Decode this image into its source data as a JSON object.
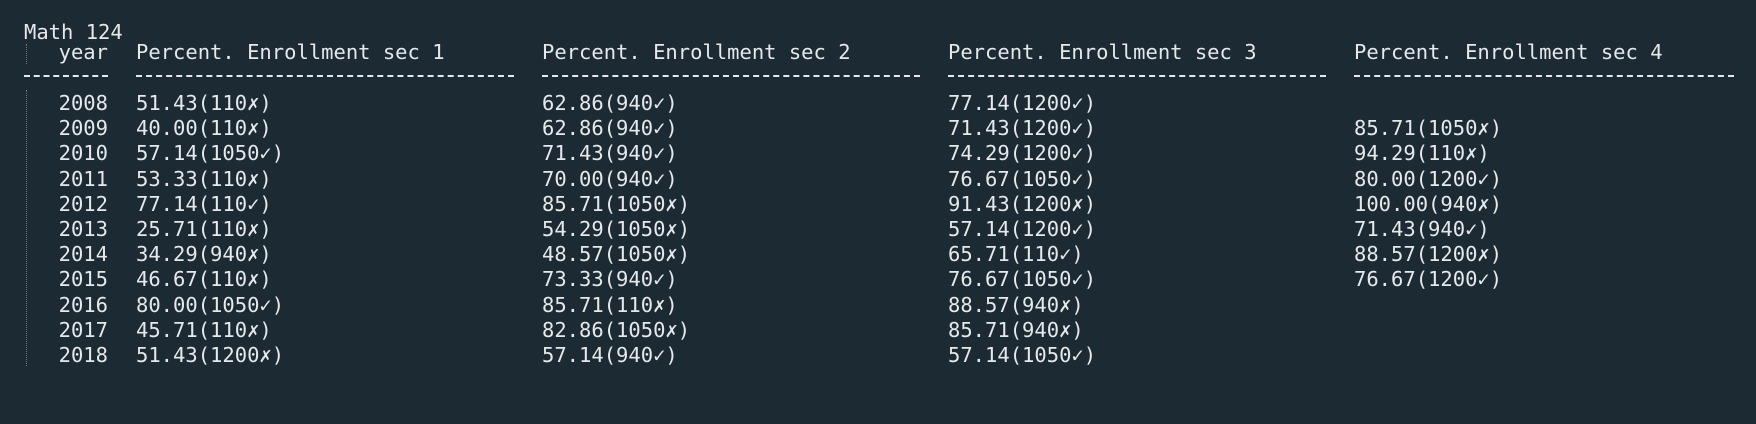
{
  "title": "Math 124",
  "columns": [
    "year",
    "Percent. Enrollment sec 1",
    "Percent. Enrollment sec 2",
    "Percent. Enrollment sec 3",
    "Percent. Enrollment sec 4"
  ],
  "rows": [
    {
      "year": "2008",
      "sec1": "51.43(110✗)",
      "sec2": "62.86(940✓)",
      "sec3": "77.14(1200✓)",
      "sec4": ""
    },
    {
      "year": "2009",
      "sec1": "40.00(110✗)",
      "sec2": "62.86(940✓)",
      "sec3": "71.43(1200✓)",
      "sec4": "85.71(1050✗)"
    },
    {
      "year": "2010",
      "sec1": "57.14(1050✓)",
      "sec2": "71.43(940✓)",
      "sec3": "74.29(1200✓)",
      "sec4": "94.29(110✗)"
    },
    {
      "year": "2011",
      "sec1": "53.33(110✗)",
      "sec2": "70.00(940✓)",
      "sec3": "76.67(1050✓)",
      "sec4": "80.00(1200✓)"
    },
    {
      "year": "2012",
      "sec1": "77.14(110✓)",
      "sec2": "85.71(1050✗)",
      "sec3": "91.43(1200✗)",
      "sec4": "100.00(940✗)"
    },
    {
      "year": "2013",
      "sec1": "25.71(110✗)",
      "sec2": "54.29(1050✗)",
      "sec3": "57.14(1200✓)",
      "sec4": "71.43(940✓)"
    },
    {
      "year": "2014",
      "sec1": "34.29(940✗)",
      "sec2": "48.57(1050✗)",
      "sec3": "65.71(110✓)",
      "sec4": "88.57(1200✗)"
    },
    {
      "year": "2015",
      "sec1": "46.67(110✗)",
      "sec2": "73.33(940✓)",
      "sec3": "76.67(1050✓)",
      "sec4": "76.67(1200✓)"
    },
    {
      "year": "2016",
      "sec1": "80.00(1050✓)",
      "sec2": "85.71(110✗)",
      "sec3": "88.57(940✗)",
      "sec4": ""
    },
    {
      "year": "2017",
      "sec1": "45.71(110✗)",
      "sec2": "82.86(1050✗)",
      "sec3": "85.71(940✗)",
      "sec4": ""
    },
    {
      "year": "2018",
      "sec1": "51.43(1200✗)",
      "sec2": "57.14(940✓)",
      "sec3": "57.14(1050✓)",
      "sec4": ""
    }
  ]
}
